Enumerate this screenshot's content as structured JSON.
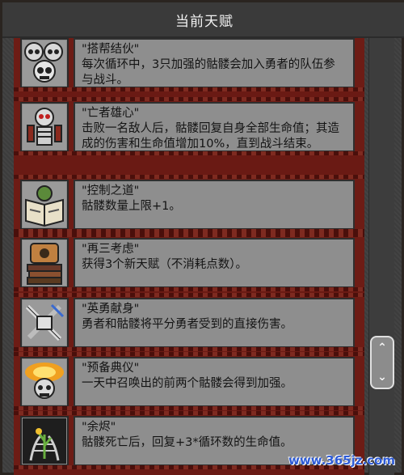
{
  "header": {
    "title": "当前天赋"
  },
  "talents": [
    {
      "name": "\"搭帮结伙\"",
      "desc": "每次循环中，3只加强的骷髅会加入勇者的队伍参与战斗。",
      "icon": "skull-pile-icon"
    },
    {
      "name": "\"亡者雄心\"",
      "desc": "击败一名敌人后，骷髅回复自身全部生命值；其造成的伤害和生命值增加10%，直到战斗结束。",
      "icon": "skeleton-warrior-icon"
    },
    {
      "name": "\"控制之道\"",
      "desc": "骷髅数量上限+1。",
      "icon": "open-book-icon"
    },
    {
      "name": "\"再三考虑\"",
      "desc": "获得3个新天赋（不消耗点数）。",
      "icon": "book-stack-icon"
    },
    {
      "name": "\"英勇献身\"",
      "desc": "勇者和骷髅将平分勇者受到的直接伤害。",
      "icon": "bones-weapons-icon"
    },
    {
      "name": "\"预备典仪\"",
      "desc": "一天中召唤出的前两个骷髅会得到加强。",
      "icon": "glowing-skull-icon"
    },
    {
      "name": "\"余烬\"",
      "desc": "骷髅死亡后，回复+3*循环数的生命值。",
      "icon": "ember-ribcage-icon"
    }
  ],
  "scrollbar": {
    "up": "⌃",
    "down": "⌄"
  },
  "watermark": "www.365jz.com",
  "colors": {
    "row_bg": "#6d1c15",
    "card_bg": "#8e8e8e",
    "text": "#141414",
    "accent": "#2d5bd6"
  }
}
